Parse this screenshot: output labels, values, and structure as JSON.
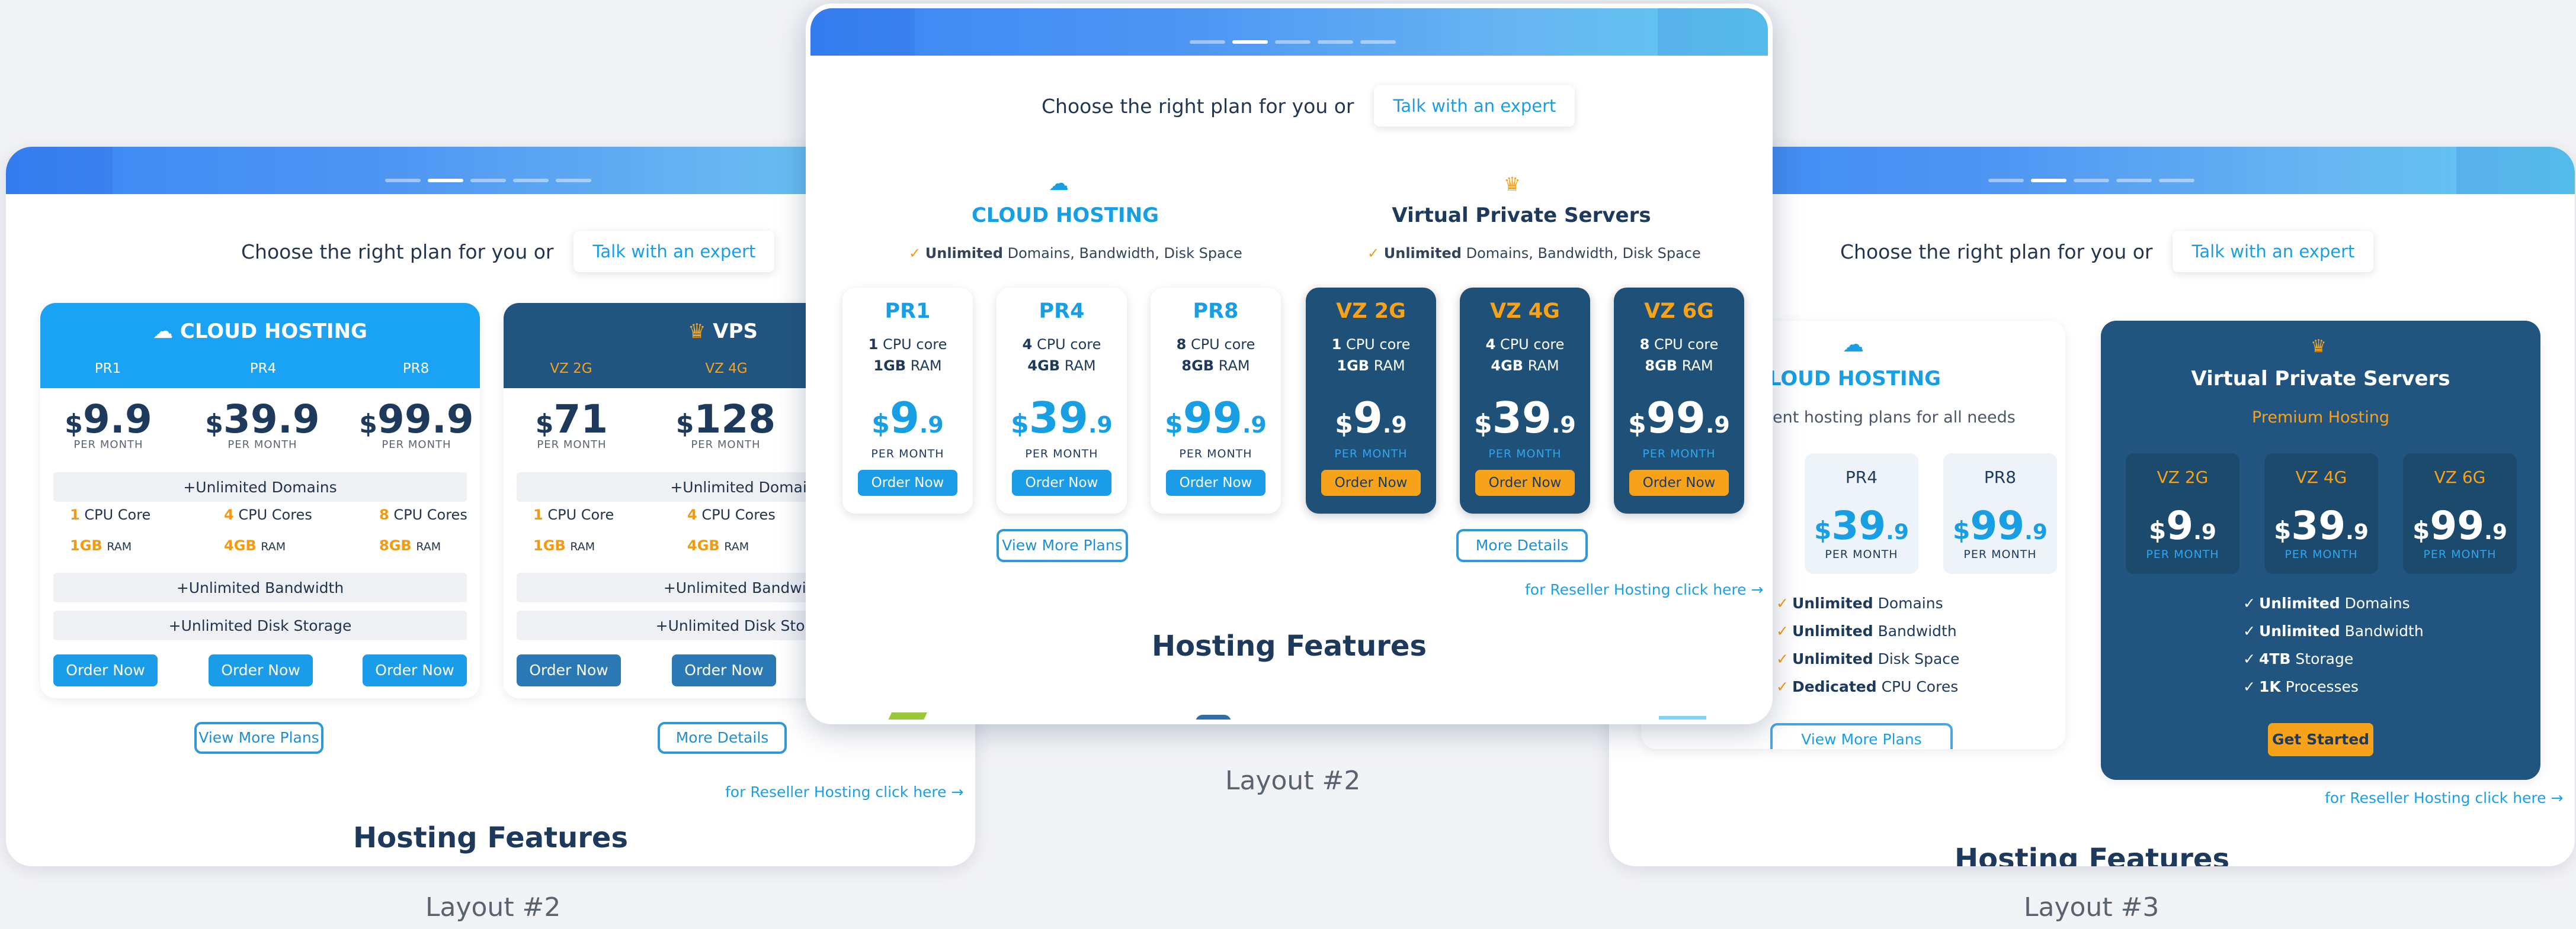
{
  "common": {
    "intro": "Choose the right plan for you or",
    "expert": "Talk with an expert",
    "features": "Hosting Features",
    "reseller": "for Reseller Hosting click here →",
    "view_more": "View More Plans",
    "more_details": "More Details",
    "order": "Order Now",
    "per_month": "PER MONTH",
    "unlimited": "Unlimited"
  },
  "layout_left": {
    "label": "Layout #2",
    "cloud": {
      "title": "CLOUD HOSTING",
      "cols": [
        "PR1",
        "PR4",
        "PR8"
      ],
      "prices": [
        {
          "cur": "$",
          "amt": "9.9"
        },
        {
          "cur": "$",
          "amt": "39.9"
        },
        {
          "cur": "$",
          "amt": "99.9"
        }
      ],
      "row_domains": "+Unlimited Domains",
      "cores": [
        {
          "n": "1",
          "t": "CPU Core"
        },
        {
          "n": "4",
          "t": "CPU Cores"
        },
        {
          "n": "8",
          "t": "CPU Cores"
        }
      ],
      "ram": [
        {
          "n": "1GB",
          "t": "RAM"
        },
        {
          "n": "4GB",
          "t": "RAM"
        },
        {
          "n": "8GB",
          "t": "RAM"
        }
      ],
      "row_bandwidth": "+Unlimited Bandwidth",
      "row_storage": "+Unlimited Disk Storage"
    },
    "vps": {
      "title": "VPS",
      "cols": [
        "VZ 2G",
        "VZ 4G"
      ],
      "prices": [
        {
          "cur": "$",
          "amt": "71"
        },
        {
          "cur": "$",
          "amt": "128"
        }
      ],
      "row_domains": "+Unlimited Domains",
      "cores": [
        {
          "n": "1",
          "t": "CPU Core"
        },
        {
          "n": "4",
          "t": "CPU Cores"
        }
      ],
      "ram": [
        {
          "n": "1GB",
          "t": "RAM"
        },
        {
          "n": "4GB",
          "t": "RAM"
        }
      ],
      "row_bandwidth": "+Unlimited Bandwidth",
      "row_storage": "+Unlimited Disk Storage"
    }
  },
  "layout_center": {
    "label": "Layout #2",
    "cloud": {
      "title": "CLOUD HOSTING",
      "sub_bold": "Unlimited",
      "sub": " Domains, Bandwidth, Disk Space"
    },
    "vps": {
      "title": "Virtual Private Servers",
      "sub_bold": "Unlimited",
      "sub": " Domains, Bandwidth, Disk Space"
    },
    "tiles": [
      {
        "name": "PR1",
        "n1": "1",
        "l1": "CPU core",
        "n2": "1GB",
        "l2": "RAM",
        "cur": "$",
        "amt": "9",
        "dec": ".9"
      },
      {
        "name": "PR4",
        "n1": "4",
        "l1": "CPU core",
        "n2": "4GB",
        "l2": "RAM",
        "cur": "$",
        "amt": "39",
        "dec": ".9"
      },
      {
        "name": "PR8",
        "n1": "8",
        "l1": "CPU core",
        "n2": "8GB",
        "l2": "RAM",
        "cur": "$",
        "amt": "99",
        "dec": ".9"
      },
      {
        "name": "VZ 2G",
        "n1": "1",
        "l1": "CPU core",
        "n2": "1GB",
        "l2": "RAM",
        "cur": "$",
        "amt": "9",
        "dec": ".9"
      },
      {
        "name": "VZ 4G",
        "n1": "4",
        "l1": "CPU core",
        "n2": "4GB",
        "l2": "RAM",
        "cur": "$",
        "amt": "39",
        "dec": ".9"
      },
      {
        "name": "VZ 6G",
        "n1": "8",
        "l1": "CPU core",
        "n2": "8GB",
        "l2": "RAM",
        "cur": "$",
        "amt": "99",
        "dec": ".9"
      }
    ]
  },
  "layout_right": {
    "label": "Layout #3",
    "cloud": {
      "title": "CLOUD HOSTING",
      "sub": "ent hosting plans for all needs",
      "plans": [
        {
          "n": "PR4",
          "cur": "$",
          "amt": "39",
          "dec": ".9"
        },
        {
          "n": "PR8",
          "cur": "$",
          "amt": "99",
          "dec": ".9"
        }
      ],
      "features": [
        {
          "b": "Unlimited",
          "t": " Domains"
        },
        {
          "b": "Unlimited",
          "t": " Bandwidth"
        },
        {
          "b": "Unlimited",
          "t": " Disk Space"
        },
        {
          "b": "Dedicated",
          "t": " CPU Cores"
        }
      ]
    },
    "vps": {
      "title": "Virtual Private Servers",
      "sub": "Premium Hosting",
      "plans": [
        {
          "n": "VZ 2G",
          "cur": "$",
          "amt": "9",
          "dec": ".9"
        },
        {
          "n": "VZ 4G",
          "cur": "$",
          "amt": "39",
          "dec": ".9"
        },
        {
          "n": "VZ 6G",
          "cur": "$",
          "amt": "99",
          "dec": ".9"
        }
      ],
      "features": [
        {
          "b": "Unlimited",
          "t": " Domains"
        },
        {
          "b": "Unlimited",
          "t": " Bandwidth"
        },
        {
          "b": "4TB",
          "t": " Storage"
        },
        {
          "b": "1K",
          "t": " Processes"
        }
      ],
      "cta": "Get Started"
    }
  },
  "colors": {
    "accent": "#189fe3",
    "orange": "#f6a21b",
    "navy": "#1f5077"
  }
}
